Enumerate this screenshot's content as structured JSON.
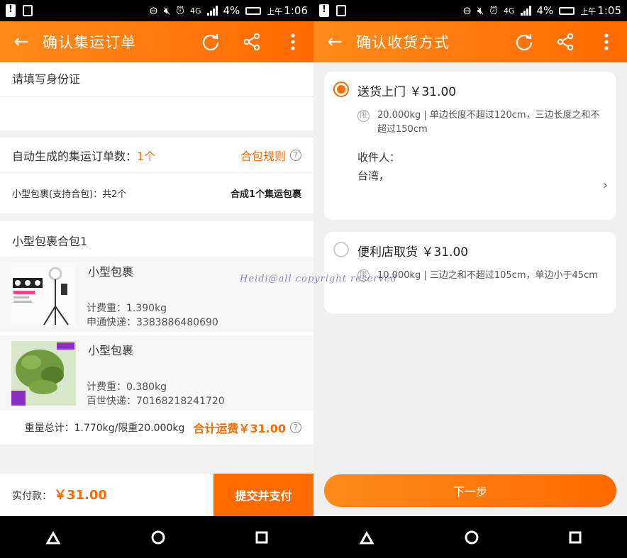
{
  "left": {
    "status": {
      "battery": "4%",
      "ampm": "上午",
      "time": "1:06",
      "network": "4G"
    },
    "appbar": {
      "title": "确认集运订单"
    },
    "idcard": {
      "label": "请填写身份证"
    },
    "orders": {
      "label": "自动生成的集运订单数：",
      "count": "1个",
      "rules": "合包规则"
    },
    "summary": {
      "left": "小型包裹(支持合包)：共2个",
      "right": "合成1个集运包裹"
    },
    "group": {
      "title": "小型包裹合包1"
    },
    "packages": [
      {
        "name": "小型包裹",
        "weight": "计费重：1.390kg",
        "tracking": "申通快递：3383886480690"
      },
      {
        "name": "小型包裹",
        "weight": "计费重：0.380kg",
        "tracking": "百世快递：70168218241720"
      }
    ],
    "totals": {
      "weight": "重量总计：1.770kg/限重20.000kg",
      "fee": "合计运费￥31.00"
    },
    "footer": {
      "pay_label": "实付款：",
      "pay_amount": "￥31.00",
      "submit": "提交并支付"
    }
  },
  "right": {
    "status": {
      "battery": "4%",
      "ampm": "上午",
      "time": "1:05",
      "network": "4G"
    },
    "appbar": {
      "title": "确认收货方式"
    },
    "options": [
      {
        "title": "送货上门 ￥31.00",
        "selected": true,
        "limit_icon": "限",
        "desc": "20.000kg  | 单边长度不超过120cm，三边长度之和不超过150cm",
        "receiver_label": "收件人：",
        "address": "台湾，"
      },
      {
        "title": "便利店取货 ￥31.00",
        "selected": false,
        "limit_icon": "限",
        "desc": "10.000kg  | 三边之和不超过105cm，单边小于45cm"
      }
    ],
    "next": "下一步"
  },
  "watermark": "Heidi@all copyright reserved",
  "colors": {
    "accent": "#ff6a00",
    "accent_light": "#ff8a1a"
  }
}
